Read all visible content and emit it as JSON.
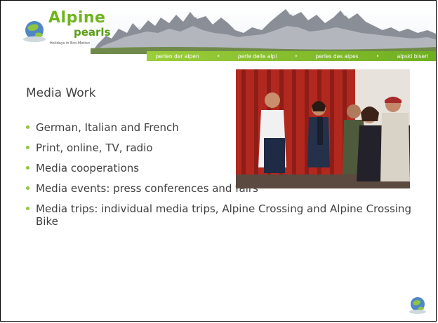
{
  "header": {
    "logo": {
      "word1": "Alpine",
      "word2": "pearls",
      "tagline": "Holidays in Eco-Motion"
    },
    "nav": [
      "perlen der alpen",
      "perle delle alpi",
      "perles des alpes",
      "alpski biseri"
    ],
    "nav_separator": "•",
    "accent_color": "#8ec63f"
  },
  "slide": {
    "title": "Media Work",
    "bullets": [
      "German, Italian and French",
      "Print, online, TV, radio",
      "Media cooperations",
      "Media events: press conferences and fairs",
      "Media trips: individual media trips, Alpine Crossing and Alpine Crossing Bike"
    ],
    "photo_icon": "photo-people-at-press-event",
    "footer_icon": "globe-icon"
  }
}
